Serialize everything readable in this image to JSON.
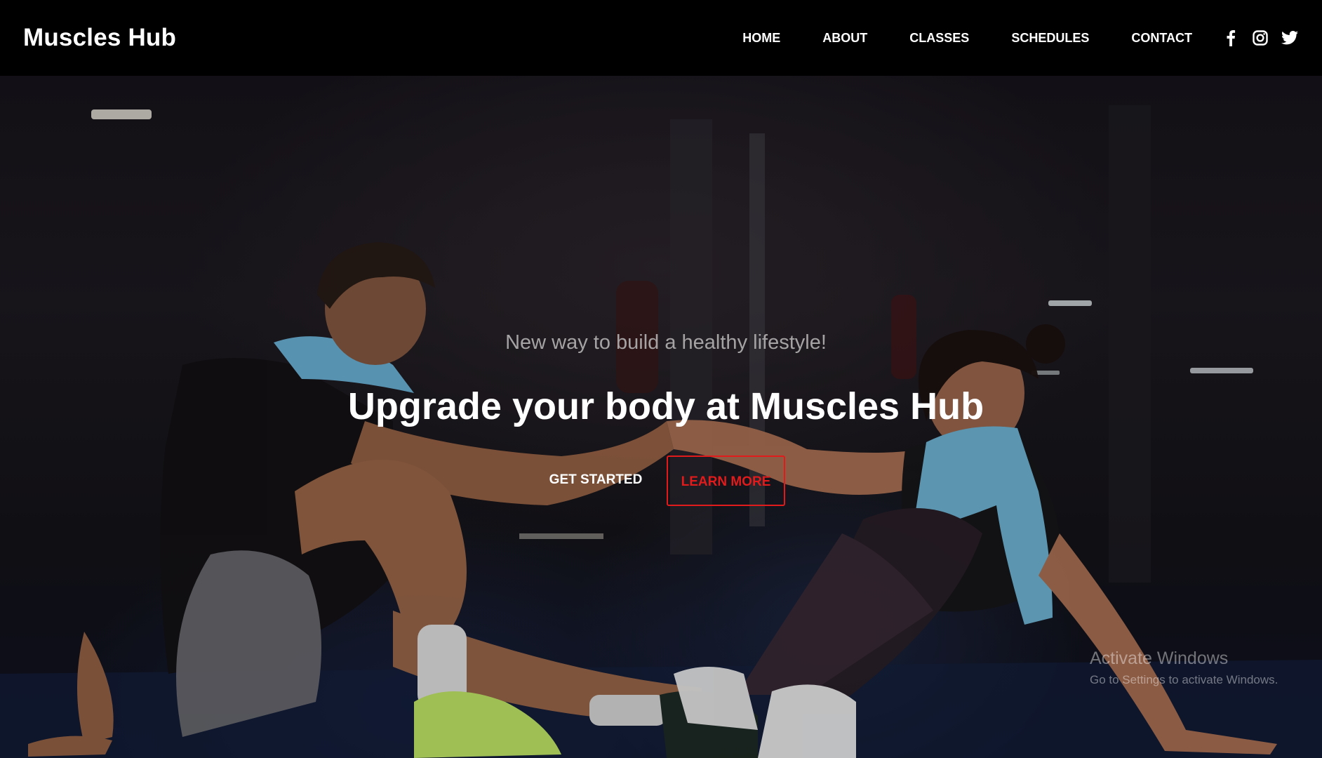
{
  "header": {
    "logo": "Muscles Hub",
    "nav": [
      {
        "label": "HOME"
      },
      {
        "label": "ABOUT"
      },
      {
        "label": "CLASSES"
      },
      {
        "label": "SCHEDULES"
      },
      {
        "label": "CONTACT"
      }
    ],
    "socials": [
      "facebook-icon",
      "instagram-icon",
      "twitter-icon"
    ]
  },
  "hero": {
    "tagline": "New way to build a healthy lifestyle!",
    "headline": "Upgrade your body at Muscles Hub",
    "primary_button": "GET STARTED",
    "secondary_button": "LEARN MORE",
    "background_image": "two people sitting on a gym floor, shaking hands"
  },
  "watermark": {
    "title": "Activate Windows",
    "subtitle": "Go to Settings to activate Windows."
  },
  "colors": {
    "header_bg": "#000000",
    "accent_red": "#e11b1b",
    "text_white": "#ffffff",
    "tagline_gray": "#a6a3a4"
  }
}
